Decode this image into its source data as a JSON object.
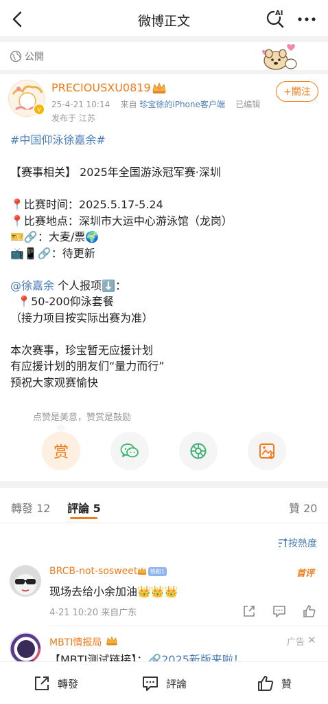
{
  "nav": {
    "title": "微博正文",
    "back_icon": "back-arrow-icon",
    "ai_icon": "ai-search-icon",
    "ai_label": "AI",
    "more_icon": "more-dots-icon"
  },
  "visibility": {
    "label": "公開",
    "icon": "globe-icon"
  },
  "author": {
    "name": "PRECIOUSXU0819",
    "time": "25-4-21 10:14",
    "source_prefix": "来自",
    "device": "珍宝徐的iPhone客户端",
    "edited": "已编辑",
    "location": "发布于 江苏",
    "follow_label": "+關注",
    "verified_mark": "v"
  },
  "post": {
    "topic": "#中国仰泳徐嘉余#",
    "heading": "【赛事相关】 2025年全国游泳冠军赛·深圳",
    "time_line": "📍比赛时间：2025.5.17-5.24",
    "venue_line": "📍比赛地点：深圳市大运中心游泳馆（龙岗）",
    "ticket_line": "🎫🔗：大麦/票🌍",
    "stream_line": "📺📱🔗：待更新",
    "mention": "@徐嘉余",
    "events_suffix": " 个人报项⬇️：",
    "events_line": "  📍50-200仰泳套餐",
    "relay_note": "（接力项目按实际出赛为准）",
    "closing_1": "本次赛事，珍宝暂无应援计划",
    "closing_2": "有应援计划的朋友们“量力而行”",
    "closing_3": "预祝大家观赛愉快"
  },
  "reward": {
    "tip": "点赞是美意，赞赏是鼓励",
    "reward_label": "赏",
    "share_icons": [
      "wechat-icon",
      "moments-icon",
      "save-image-icon"
    ]
  },
  "tabs": {
    "repost_label": "轉發",
    "repost_count": "12",
    "comment_label": "評論",
    "comment_count": "5",
    "like_label": "贊",
    "like_count": "20"
  },
  "sort": {
    "label": "按熱度"
  },
  "comment": {
    "name": "BRCB-not-sosweet",
    "badge": "铁粉1",
    "hot_tag": "首评",
    "text": "现场去给小余加油👑👑👑",
    "meta": "4-21 10:20  来自广东"
  },
  "ad": {
    "name": "MBTI情报局",
    "label": "广告",
    "close": "✕",
    "text_prefix": "【MBTI测试链接】：",
    "text_link": "🔗2025新版来啦！"
  },
  "bottom": {
    "repost": "轉發",
    "comment": "評論",
    "like": "贊"
  },
  "colors": {
    "accent": "#f27b1a",
    "link": "#4a7db8",
    "muted": "#999999"
  }
}
